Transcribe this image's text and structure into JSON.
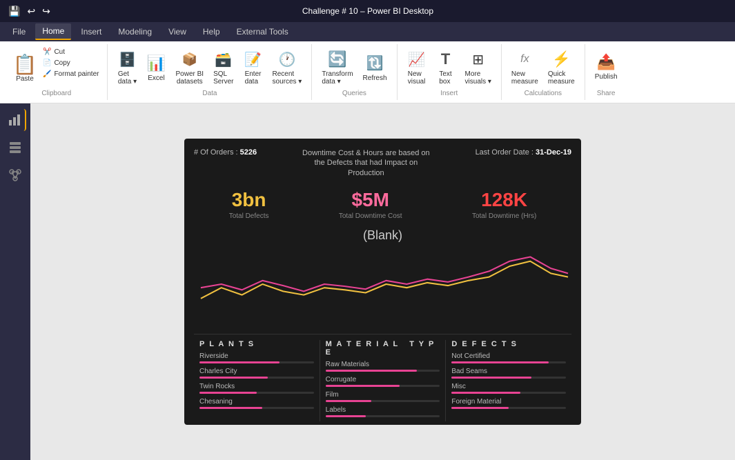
{
  "titlebar": {
    "title": "Challenge # 10 – Power BI Desktop",
    "save_icon": "💾",
    "undo_icon": "↩",
    "redo_icon": "↪"
  },
  "menubar": {
    "items": [
      {
        "label": "File",
        "active": false
      },
      {
        "label": "Home",
        "active": true
      },
      {
        "label": "Insert",
        "active": false
      },
      {
        "label": "Modeling",
        "active": false
      },
      {
        "label": "View",
        "active": false
      },
      {
        "label": "Help",
        "active": false
      },
      {
        "label": "External Tools",
        "active": false
      }
    ]
  },
  "ribbon": {
    "groups": [
      {
        "name": "Clipboard",
        "label": "Clipboard",
        "buttons": [
          {
            "id": "paste",
            "label": "Paste",
            "icon": "📋",
            "large": true
          },
          {
            "id": "cut",
            "label": "Cut",
            "icon": "✂️",
            "small": true
          },
          {
            "id": "copy",
            "label": "Copy",
            "icon": "📄",
            "small": true
          },
          {
            "id": "format-painter",
            "label": "Format painter",
            "icon": "🖌️",
            "small": true
          }
        ]
      },
      {
        "name": "Data",
        "label": "Data",
        "buttons": [
          {
            "id": "get-data",
            "label": "Get data",
            "icon": "🗄️"
          },
          {
            "id": "excel",
            "label": "Excel",
            "icon": "📊"
          },
          {
            "id": "power-bi-datasets",
            "label": "Power BI datasets",
            "icon": "📦"
          },
          {
            "id": "sql-server",
            "label": "SQL Server",
            "icon": "🗃️"
          },
          {
            "id": "enter-data",
            "label": "Enter data",
            "icon": "📝"
          },
          {
            "id": "recent-sources",
            "label": "Recent sources",
            "icon": "🕐"
          }
        ]
      },
      {
        "name": "Queries",
        "label": "Queries",
        "buttons": [
          {
            "id": "transform-data",
            "label": "Transform data",
            "icon": "🔄"
          },
          {
            "id": "refresh",
            "label": "Refresh",
            "icon": "🔃"
          }
        ]
      },
      {
        "name": "Insert",
        "label": "Insert",
        "buttons": [
          {
            "id": "new-visual",
            "label": "New visual",
            "icon": "📈"
          },
          {
            "id": "text-box",
            "label": "Text box",
            "icon": "T"
          },
          {
            "id": "more-visuals",
            "label": "More visuals",
            "icon": "⊞"
          }
        ]
      },
      {
        "name": "Calculations",
        "label": "Calculations",
        "buttons": [
          {
            "id": "new-measure",
            "label": "New measure",
            "icon": "fx"
          },
          {
            "id": "quick-measure",
            "label": "Quick measure",
            "icon": "⚡"
          }
        ]
      },
      {
        "name": "Share",
        "label": "Share",
        "buttons": [
          {
            "id": "publish",
            "label": "Publish",
            "icon": "📤"
          }
        ]
      }
    ]
  },
  "sidebar": {
    "icons": [
      {
        "id": "report",
        "label": "Report",
        "icon": "📊",
        "active": true
      },
      {
        "id": "data",
        "label": "Data",
        "icon": "⊞",
        "active": false
      },
      {
        "id": "model",
        "label": "Model",
        "icon": "⋈",
        "active": false
      }
    ]
  },
  "dashboard": {
    "header": {
      "orders_label": "# Of Orders :",
      "orders_value": "5226",
      "note": "Downtime Cost & Hours are based on the Defects that had Impact on Production",
      "last_order_label": "Last Order Date :",
      "last_order_value": "31-Dec-19"
    },
    "kpis": [
      {
        "id": "total-defects",
        "value": "3bn",
        "label": "Total Defects",
        "color": "gold"
      },
      {
        "id": "total-downtime-cost",
        "value": "$5M",
        "label": "Total Downtime Cost",
        "color": "pink"
      },
      {
        "id": "total-downtime-hrs",
        "value": "128K",
        "label": "Total Downtime (Hrs)",
        "color": "red"
      }
    ],
    "blank_label": "(Blank)",
    "filters": [
      {
        "id": "plants",
        "title": "P l a n t s",
        "items": [
          {
            "label": "Riverside",
            "fill_pct": 70
          },
          {
            "label": "Charles City",
            "fill_pct": 60
          },
          {
            "label": "Twin Rocks",
            "fill_pct": 50
          },
          {
            "label": "Chesaning",
            "fill_pct": 55
          }
        ]
      },
      {
        "id": "material-type",
        "title": "M a t e r i a l   T y p e",
        "items": [
          {
            "label": "Raw Materials",
            "fill_pct": 80
          },
          {
            "label": "Corrugate",
            "fill_pct": 65
          },
          {
            "label": "Film",
            "fill_pct": 40
          },
          {
            "label": "Labels",
            "fill_pct": 35
          }
        ]
      },
      {
        "id": "defects",
        "title": "D e f e c t s",
        "items": [
          {
            "label": "Not Certified",
            "fill_pct": 85
          },
          {
            "label": "Bad Seams",
            "fill_pct": 70
          },
          {
            "label": "Misc",
            "fill_pct": 60
          },
          {
            "label": "Foreign Material",
            "fill_pct": 50
          }
        ]
      }
    ]
  }
}
